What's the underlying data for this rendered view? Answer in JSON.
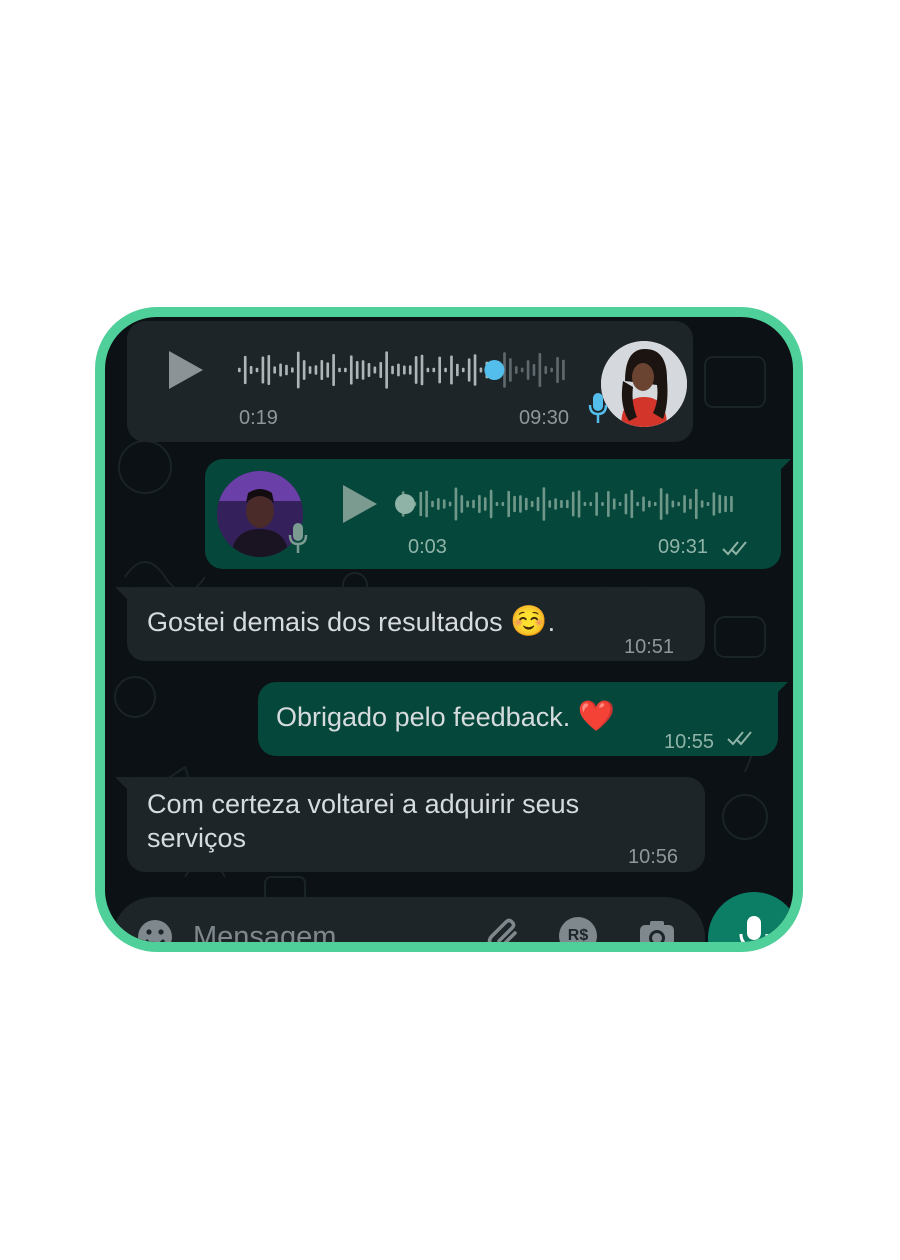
{
  "messages": [
    {
      "type": "audio",
      "direction": "incoming",
      "duration": "0:19",
      "time": "09:30",
      "avatar_icon": "contact-photo-woman",
      "progress": 0.78
    },
    {
      "type": "audio",
      "direction": "outgoing",
      "duration": "0:03",
      "time": "09:31",
      "avatar_icon": "contact-photo-man",
      "status_icon": "double-check-icon",
      "progress": 0.0
    },
    {
      "type": "text",
      "direction": "incoming",
      "text": "Gostei demais dos resultados",
      "emoji": "☺️",
      "suffix": ".",
      "time": "10:51"
    },
    {
      "type": "text",
      "direction": "outgoing",
      "text": "Obrigado pelo feedback.",
      "emoji": "❤️",
      "time": "10:55",
      "status_icon": "double-check-icon"
    },
    {
      "type": "text",
      "direction": "incoming",
      "text_line1": "Com certeza voltarei a adquirir seus",
      "text_line2": "serviços",
      "time": "10:56"
    }
  ],
  "input": {
    "placeholder": "Mensagem",
    "icons": [
      "emoji-icon",
      "attach-icon",
      "payment-icon",
      "camera-icon",
      "mic-icon"
    ],
    "payment_label": "R$"
  },
  "colors": {
    "frame_border": "#4fcf99",
    "background": "#0b1114",
    "incoming_bubble": "#1d2529",
    "outgoing_bubble": "#06473b",
    "accent": "#0d7e66",
    "progress_dot": "#53bdeb"
  }
}
